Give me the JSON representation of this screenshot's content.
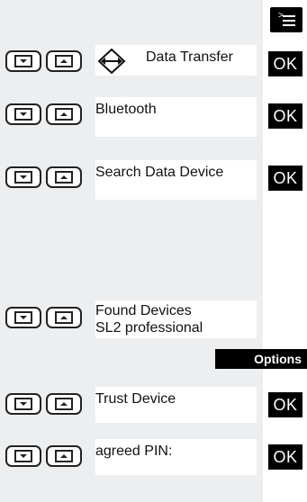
{
  "menu_key": {
    "icon": "menu-list-icon"
  },
  "steps": [
    {
      "label": "Data Transfer",
      "icon": "data-transfer-icon",
      "action": "OK"
    },
    {
      "label": "Bluetooth",
      "action": "OK"
    },
    {
      "label": "Search Data Device",
      "action": "OK"
    },
    {
      "label_line1": "Found Devices",
      "label_line2": "SL2 professional"
    },
    {
      "label": "Trust Device",
      "action": "OK"
    },
    {
      "label": "agreed PIN:",
      "action": "OK"
    }
  ],
  "options_label": "Options",
  "nav_keys": {
    "down_icon": "nav-down-key-icon",
    "up_icon": "nav-up-key-icon"
  }
}
